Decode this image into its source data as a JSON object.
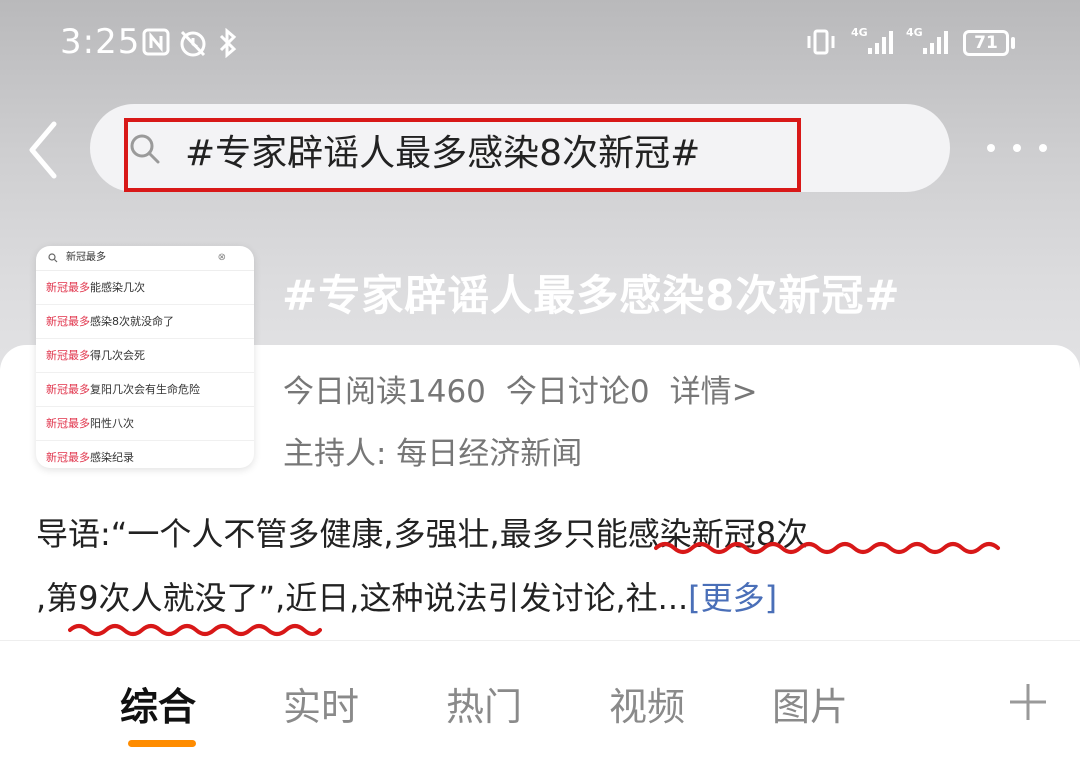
{
  "status_bar": {
    "time": "3:25",
    "network_1": "4G",
    "network_2": "4G",
    "battery": "71"
  },
  "search": {
    "query": "#专家辟谣人最多感染8次新冠#"
  },
  "thumbnail": {
    "search_text": "新冠最多",
    "rows": [
      {
        "highlight": "新冠最多",
        "rest": "能感染几次"
      },
      {
        "highlight": "新冠最多",
        "rest": "感染8次就没命了"
      },
      {
        "highlight": "新冠最多",
        "rest": "得几次会死"
      },
      {
        "highlight": "新冠最多",
        "rest": "复阳几次会有生命危险"
      },
      {
        "highlight": "新冠最多",
        "rest": "阳性八次"
      },
      {
        "highlight": "新冠最多",
        "rest": "感染纪录"
      }
    ]
  },
  "topic": {
    "title": "#专家辟谣人最多感染8次新冠#",
    "reads": "今日阅读1460",
    "discussions": "今日讨论0",
    "details": "详情>",
    "host": "主持人:  每日经济新闻"
  },
  "intro": {
    "line1_a": "导语:“一个人不管多健康,多强壮,",
    "line1_b": "最多只能感染新冠8次",
    "line2_a": ",",
    "line2_b": "第9次人就没了",
    "line2_c": "”,近日,这种说法引发讨论,社...",
    "more": "[更多]"
  },
  "tabs": {
    "items": [
      "综合",
      "实时",
      "热门",
      "视频",
      "图片"
    ],
    "active_index": 0
  },
  "colors": {
    "accent": "#ff8c00",
    "annotation_red": "#d81818",
    "link_blue": "#4a6fb8",
    "highlight_pink": "#e0324a"
  }
}
